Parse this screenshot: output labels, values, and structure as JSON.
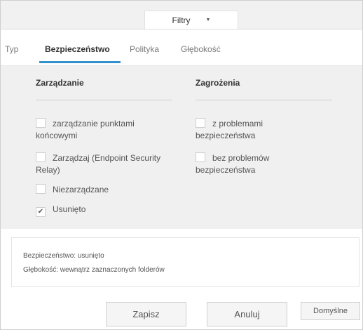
{
  "filter_dropdown": {
    "label": "Filtry"
  },
  "tabs": [
    {
      "label": "Typ"
    },
    {
      "label": "Bezpieczeństwo"
    },
    {
      "label": "Polityka"
    },
    {
      "label": "Głębokość"
    }
  ],
  "management": {
    "heading": "Zarządzanie",
    "options": [
      {
        "label": "zarządzanie punktami końcowymi",
        "checked": false
      },
      {
        "label": "Zarządzaj (Endpoint Security Relay)",
        "checked": false
      },
      {
        "label": "Niezarządzane",
        "checked": false
      },
      {
        "label": "Usunięto",
        "checked": true
      }
    ]
  },
  "threats": {
    "heading": "Zagrożenia",
    "options": [
      {
        "label": "z problemami bezpieczeństwa",
        "checked": false
      },
      {
        "label": "bez problemów bezpieczeństwa",
        "checked": false
      }
    ]
  },
  "summary": {
    "line1": "Bezpieczeństwo: usunięto",
    "line2": "Głębokość: wewnątrz zaznaczonych folderów"
  },
  "buttons": {
    "save": "Zapisz",
    "cancel": "Anuluj",
    "defaults": "Domyślne"
  },
  "check_mark": "✔"
}
